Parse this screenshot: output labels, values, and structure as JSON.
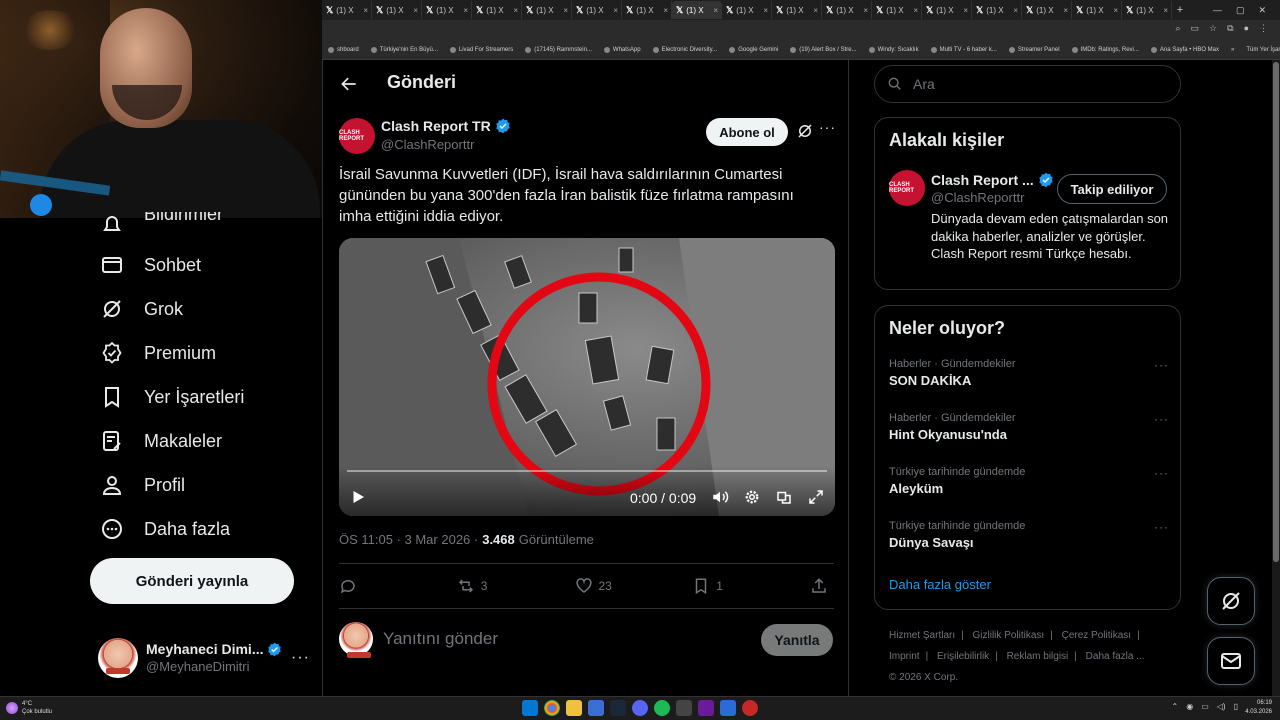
{
  "browser": {
    "tab_label": "(1) X",
    "tab_count": 17,
    "bookmarks": [
      "shboard",
      "Türkiye'nin En Büyü...",
      "Livad For Streamers",
      "(17145) Rammstein...",
      "WhatsApp",
      "Electronic Diversity...",
      "Google Gemini",
      "(19) Alert Box / Stre...",
      "Windy: Sıcaklık",
      "Multi TV - 6 haber k...",
      "Streamer Panel",
      "IMDb: Ratings, Revi...",
      "Ana Sayfa • HBO Max"
    ],
    "bookmarks_more": "»",
    "all_bookmarks": "Tüm Yer İşaretleri"
  },
  "nav": {
    "partial_label": "Bildirimler",
    "items": [
      {
        "label": "Sohbet",
        "icon": "mail-icon"
      },
      {
        "label": "Grok",
        "icon": "grok-icon"
      },
      {
        "label": "Premium",
        "icon": "premium-badge-icon"
      },
      {
        "label": "Yer İşaretleri",
        "icon": "bookmark-icon"
      },
      {
        "label": "Makaleler",
        "icon": "article-icon"
      },
      {
        "label": "Profil",
        "icon": "profile-icon"
      },
      {
        "label": "Daha fazla",
        "icon": "more-circle-icon"
      }
    ],
    "post_button": "Gönderi yayınla",
    "account": {
      "display_name": "Meyhaneci Dimi...",
      "handle": "@MeyhaneDimitri",
      "more": "···"
    }
  },
  "main": {
    "title": "Gönderi",
    "tweet": {
      "author_name": "Clash Report TR",
      "author_handle": "@ClashReporttr",
      "avatar_text": "CLASH REPORT",
      "subscribe_label": "Abone ol",
      "text": "İsrail Savunma Kuvvetleri (IDF), İsrail hava saldırılarının Cumartesi gününden bu yana 300'den fazla İran balistik füze fırlatma rampasını imha ettiğini iddia ediyor.",
      "video_time": "0:00 / 0:09",
      "video_progress": 0,
      "timestamp": "ÖS 11:05 · 3 Mar 2026 · ",
      "views": "3.468",
      "views_label": "Görüntüleme",
      "replies": "",
      "reposts": "3",
      "likes": "23",
      "bookmarks": "1"
    },
    "reply_placeholder": "Yanıtını gönder",
    "reply_button": "Yanıtla"
  },
  "right": {
    "search_placeholder": "Ara",
    "related": {
      "title": "Alakalı kişiler",
      "name": "Clash Report ...",
      "handle": "@ClashReporttr",
      "avatar_text": "CLASH REPORT",
      "follow_label": "Takip ediliyor",
      "bio": "Dünyada devam eden çatışmalardan son dakika haberler, analizler ve görüşler. Clash Report resmi Türkçe hesabı."
    },
    "trends": {
      "title": "Neler oluyor?",
      "items": [
        {
          "context": "Haberler · Gündemdekiler",
          "name": "SON DAKİKA"
        },
        {
          "context": "Haberler · Gündemdekiler",
          "name": "Hint Okyanusu'nda"
        },
        {
          "context": "Türkiye tarihinde gündemde",
          "name": "Aleyküm"
        },
        {
          "context": "Türkiye tarihinde gündemde",
          "name": "Dünya Savaşı"
        }
      ],
      "show_more": "Daha fazla göster"
    },
    "footer": {
      "links": [
        "Hizmet Şartları",
        "Gizlilik Politikası",
        "Çerez Politikası",
        "Imprint",
        "Erişilebilirlik",
        "Reklam bilgisi",
        "Daha fazla ..."
      ],
      "copyright": "© 2026 X Corp."
    }
  },
  "taskbar": {
    "weather_temp": "4°C",
    "weather_desc": "Çok bulutlu",
    "time": "06:19",
    "date": "4.03.2026"
  },
  "colors": {
    "accent": "#1d9bf0",
    "verified": "#1d9bf0",
    "brand_red": "#c41230",
    "circle_red": "#e30613"
  }
}
